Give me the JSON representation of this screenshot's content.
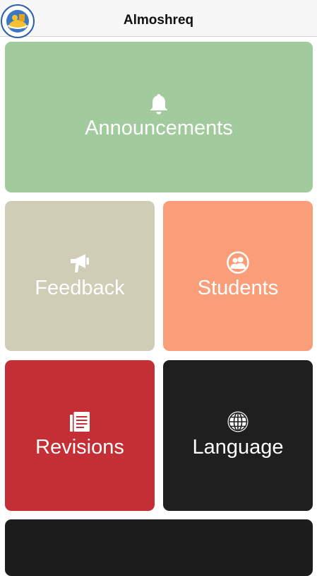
{
  "header": {
    "title": "Almoshreq",
    "logo_icon": "school-logo-icon"
  },
  "tiles": [
    {
      "id": "announcements",
      "label": "Announcements",
      "icon": "bell-icon",
      "color": "#a2cb9d"
    },
    {
      "id": "feedback",
      "label": "Feedback",
      "icon": "megaphone-icon",
      "color": "#cfcdb5"
    },
    {
      "id": "students",
      "label": "Students",
      "icon": "people-icon",
      "color": "#f99e78"
    },
    {
      "id": "revisions",
      "label": "Revisions",
      "icon": "document-icon",
      "color": "#c42f35"
    },
    {
      "id": "language",
      "label": "Language",
      "icon": "globe-icon",
      "color": "#1f1f1f"
    },
    {
      "id": "bottom",
      "label": "",
      "icon": "",
      "color": "#1c1c1c"
    }
  ]
}
